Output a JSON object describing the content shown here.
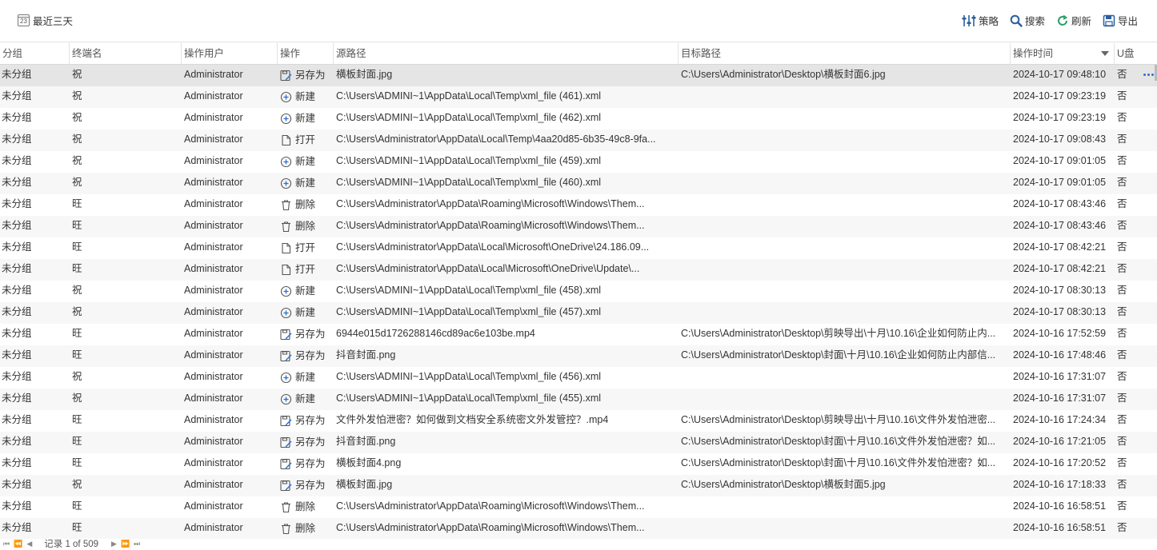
{
  "toolbar": {
    "date_filter_label": "最近三天",
    "calendar_day": "23",
    "strategy_label": "策略",
    "search_label": "搜索",
    "refresh_label": "刷新",
    "export_label": "导出"
  },
  "columns": [
    "分组",
    "终端名",
    "操作用户",
    "操作",
    "源路径",
    "目标路径",
    "操作时间",
    "U盘"
  ],
  "rows": [
    {
      "group": "未分组",
      "terminal": "祝",
      "user": "Administrator",
      "op_icon": "save-as-icon",
      "op": "另存为",
      "src": "横板封面.jpg",
      "dst": "C:\\Users\\Administrator\\Desktop\\横板封面6.jpg",
      "time": "2024-10-17 09:48:10",
      "usb": "否"
    },
    {
      "group": "未分组",
      "terminal": "祝",
      "user": "Administrator",
      "op_icon": "new-icon",
      "op": "新建",
      "src": "C:\\Users\\ADMINI~1\\AppData\\Local\\Temp\\xml_file (461).xml",
      "dst": "",
      "time": "2024-10-17 09:23:19",
      "usb": "否"
    },
    {
      "group": "未分组",
      "terminal": "祝",
      "user": "Administrator",
      "op_icon": "new-icon",
      "op": "新建",
      "src": "C:\\Users\\ADMINI~1\\AppData\\Local\\Temp\\xml_file (462).xml",
      "dst": "",
      "time": "2024-10-17 09:23:19",
      "usb": "否"
    },
    {
      "group": "未分组",
      "terminal": "祝",
      "user": "Administrator",
      "op_icon": "open-icon",
      "op": "打开",
      "src": "C:\\Users\\Administrator\\AppData\\Local\\Temp\\4aa20d85-6b35-49c8-9fa...",
      "dst": "",
      "time": "2024-10-17 09:08:43",
      "usb": "否"
    },
    {
      "group": "未分组",
      "terminal": "祝",
      "user": "Administrator",
      "op_icon": "new-icon",
      "op": "新建",
      "src": "C:\\Users\\ADMINI~1\\AppData\\Local\\Temp\\xml_file (459).xml",
      "dst": "",
      "time": "2024-10-17 09:01:05",
      "usb": "否"
    },
    {
      "group": "未分组",
      "terminal": "祝",
      "user": "Administrator",
      "op_icon": "new-icon",
      "op": "新建",
      "src": "C:\\Users\\ADMINI~1\\AppData\\Local\\Temp\\xml_file (460).xml",
      "dst": "",
      "time": "2024-10-17 09:01:05",
      "usb": "否"
    },
    {
      "group": "未分组",
      "terminal": "旺",
      "user": "Administrator",
      "op_icon": "delete-icon",
      "op": "删除",
      "src": "C:\\Users\\Administrator\\AppData\\Roaming\\Microsoft\\Windows\\Them...",
      "dst": "",
      "time": "2024-10-17 08:43:46",
      "usb": "否"
    },
    {
      "group": "未分组",
      "terminal": "旺",
      "user": "Administrator",
      "op_icon": "delete-icon",
      "op": "删除",
      "src": "C:\\Users\\Administrator\\AppData\\Roaming\\Microsoft\\Windows\\Them...",
      "dst": "",
      "time": "2024-10-17 08:43:46",
      "usb": "否"
    },
    {
      "group": "未分组",
      "terminal": "旺",
      "user": "Administrator",
      "op_icon": "open-icon",
      "op": "打开",
      "src": "C:\\Users\\Administrator\\AppData\\Local\\Microsoft\\OneDrive\\24.186.09...",
      "dst": "",
      "time": "2024-10-17 08:42:21",
      "usb": "否"
    },
    {
      "group": "未分组",
      "terminal": "旺",
      "user": "Administrator",
      "op_icon": "open-icon",
      "op": "打开",
      "src": "C:\\Users\\Administrator\\AppData\\Local\\Microsoft\\OneDrive\\Update\\...",
      "dst": "",
      "time": "2024-10-17 08:42:21",
      "usb": "否"
    },
    {
      "group": "未分组",
      "terminal": "祝",
      "user": "Administrator",
      "op_icon": "new-icon",
      "op": "新建",
      "src": "C:\\Users\\ADMINI~1\\AppData\\Local\\Temp\\xml_file (458).xml",
      "dst": "",
      "time": "2024-10-17 08:30:13",
      "usb": "否"
    },
    {
      "group": "未分组",
      "terminal": "祝",
      "user": "Administrator",
      "op_icon": "new-icon",
      "op": "新建",
      "src": "C:\\Users\\ADMINI~1\\AppData\\Local\\Temp\\xml_file (457).xml",
      "dst": "",
      "time": "2024-10-17 08:30:13",
      "usb": "否"
    },
    {
      "group": "未分组",
      "terminal": "旺",
      "user": "Administrator",
      "op_icon": "save-as-icon",
      "op": "另存为",
      "src": "6944e015d1726288146cd89ac6e103be.mp4",
      "dst": "C:\\Users\\Administrator\\Desktop\\剪映导出\\十月\\10.16\\企业如何防止内...",
      "time": "2024-10-16 17:52:59",
      "usb": "否"
    },
    {
      "group": "未分组",
      "terminal": "旺",
      "user": "Administrator",
      "op_icon": "save-as-icon",
      "op": "另存为",
      "src": "抖音封面.png",
      "dst": "C:\\Users\\Administrator\\Desktop\\封面\\十月\\10.16\\企业如何防止内部信...",
      "time": "2024-10-16 17:48:46",
      "usb": "否"
    },
    {
      "group": "未分组",
      "terminal": "祝",
      "user": "Administrator",
      "op_icon": "new-icon",
      "op": "新建",
      "src": "C:\\Users\\ADMINI~1\\AppData\\Local\\Temp\\xml_file (456).xml",
      "dst": "",
      "time": "2024-10-16 17:31:07",
      "usb": "否"
    },
    {
      "group": "未分组",
      "terminal": "祝",
      "user": "Administrator",
      "op_icon": "new-icon",
      "op": "新建",
      "src": "C:\\Users\\ADMINI~1\\AppData\\Local\\Temp\\xml_file (455).xml",
      "dst": "",
      "time": "2024-10-16 17:31:07",
      "usb": "否"
    },
    {
      "group": "未分组",
      "terminal": "旺",
      "user": "Administrator",
      "op_icon": "save-as-icon",
      "op": "另存为",
      "src": "文件外发怕泄密？如何做到文档安全系统密文外发管控？.mp4",
      "dst": "C:\\Users\\Administrator\\Desktop\\剪映导出\\十月\\10.16\\文件外发怕泄密...",
      "time": "2024-10-16 17:24:34",
      "usb": "否"
    },
    {
      "group": "未分组",
      "terminal": "旺",
      "user": "Administrator",
      "op_icon": "save-as-icon",
      "op": "另存为",
      "src": "抖音封面.png",
      "dst": "C:\\Users\\Administrator\\Desktop\\封面\\十月\\10.16\\文件外发怕泄密？如...",
      "time": "2024-10-16 17:21:05",
      "usb": "否"
    },
    {
      "group": "未分组",
      "terminal": "旺",
      "user": "Administrator",
      "op_icon": "save-as-icon",
      "op": "另存为",
      "src": "横板封面4.png",
      "dst": "C:\\Users\\Administrator\\Desktop\\封面\\十月\\10.16\\文件外发怕泄密？如...",
      "time": "2024-10-16 17:20:52",
      "usb": "否"
    },
    {
      "group": "未分组",
      "terminal": "祝",
      "user": "Administrator",
      "op_icon": "save-as-icon",
      "op": "另存为",
      "src": "横板封面.jpg",
      "dst": "C:\\Users\\Administrator\\Desktop\\横板封面5.jpg",
      "time": "2024-10-16 17:18:33",
      "usb": "否"
    },
    {
      "group": "未分组",
      "terminal": "旺",
      "user": "Administrator",
      "op_icon": "delete-icon",
      "op": "删除",
      "src": "C:\\Users\\Administrator\\AppData\\Roaming\\Microsoft\\Windows\\Them...",
      "dst": "",
      "time": "2024-10-16 16:58:51",
      "usb": "否"
    },
    {
      "group": "未分组",
      "terminal": "旺",
      "user": "Administrator",
      "op_icon": "delete-icon",
      "op": "删除",
      "src": "C:\\Users\\Administrator\\AppData\\Roaming\\Microsoft\\Windows\\Them...",
      "dst": "",
      "time": "2024-10-16 16:58:51",
      "usb": "否"
    }
  ],
  "footer": {
    "record_label": "记录 1 of 509"
  }
}
